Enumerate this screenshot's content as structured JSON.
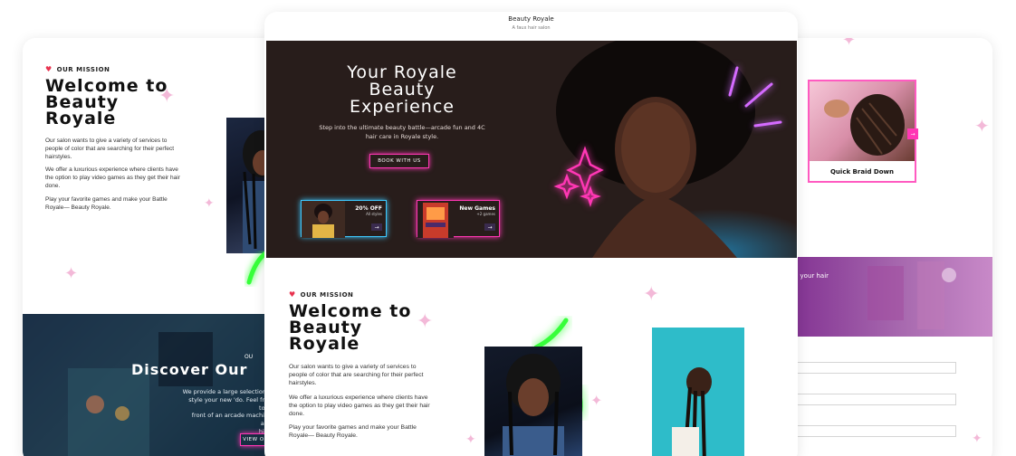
{
  "site": {
    "name": "Beauty Royale",
    "tagline": "A faux hair salon"
  },
  "hero": {
    "title": "Your Royale Beauty Experience",
    "subtitle": "Step into the ultimate beauty battle—arcade fun and 4C hair care in Royale style.",
    "cta": "BOOK WITH US",
    "promos": [
      {
        "title": "20% OFF",
        "sub": "All styles",
        "arrow": "→"
      },
      {
        "title": "New Games",
        "sub": "+2 games",
        "arrow": "→"
      }
    ]
  },
  "mission": {
    "label": "OUR MISSION",
    "title_lines": [
      "Welcome to",
      "Beauty",
      "Royale"
    ],
    "paragraphs": [
      "Our salon wants to give a variety of services to people of color that are searching for their perfect hairstyles.",
      "We offer a luxurious experience where clients have the option to play video games as they get their hair done.",
      "Play your favorite games and make your Battle Royale— Beauty Royale."
    ]
  },
  "discover": {
    "label": "OU",
    "title": "Discover Our",
    "text_lines": [
      "We provide a large selection o",
      "style your new 'do. Feel free to cl",
      "front of an arcade machine and",
      "high"
    ],
    "button": "VIEW O"
  },
  "services": {
    "card_title": "Quick Braid Down",
    "arrow": "→"
  },
  "banner": {
    "text_lines": [
      "ss your hair",
      "s!"
    ]
  },
  "colors": {
    "neon_pink": "#ff37b4",
    "neon_green": "#36ff3a",
    "hero_bg": "#281d1b",
    "purple": "#8c3b9e"
  },
  "icons": [
    "heart-icon",
    "sparkle-icon",
    "arrow-right-icon"
  ]
}
